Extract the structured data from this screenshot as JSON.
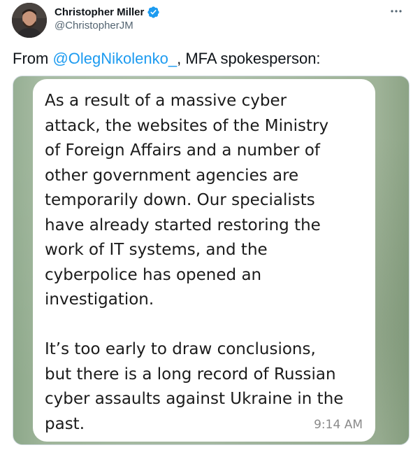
{
  "tweet": {
    "author": {
      "display_name": "Christopher Miller",
      "handle": "@ChristopherJM",
      "verified": true
    },
    "text": {
      "prefix": "From ",
      "mention": "@OlegNikolenko_",
      "suffix": ", MFA spokesperson:"
    },
    "media": {
      "message_text": "As a result of a massive cyber\nattack, the websites of the Ministry\nof Foreign Affairs and a number of\nother government agencies are\ntemporarily down. Our specialists\nhave already started restoring the\nwork of IT systems, and the\ncyberpolice has opened an\ninvestigation.\n\nIt’s too early to draw conclusions,\nbut there is a long record of Russian\ncyber assaults against Ukraine in the\npast.",
      "message_time": "9:14 AM"
    }
  },
  "icons": {
    "verified": "verified-badge-icon",
    "more": "more-options-icon"
  },
  "colors": {
    "accent": "#1d9bf0",
    "text_primary": "#0f1419",
    "text_secondary": "#536471",
    "media_background": "#a9bca5",
    "bubble": "#ffffff",
    "bubble_time": "#8a8a8a"
  }
}
